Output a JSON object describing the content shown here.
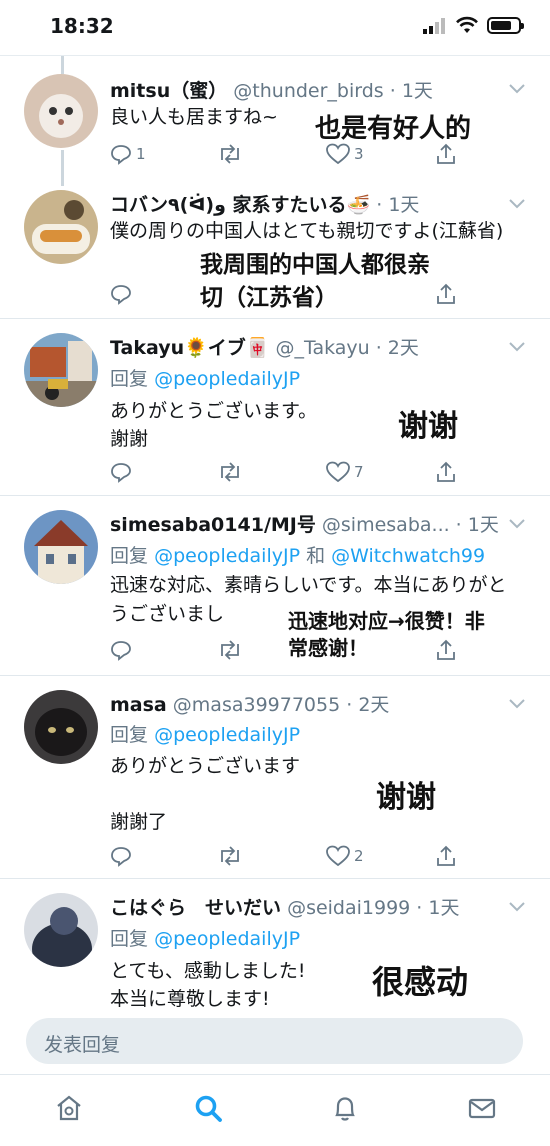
{
  "status_bar": {
    "time": "18:32"
  },
  "tweets": [
    {
      "name": "mitsu（蜜）",
      "meta": "@thunder_birds · 1天",
      "text": "良い人も居ますね~",
      "overlay": "也是有好人的",
      "reply_count": "1",
      "like_count": "3"
    },
    {
      "name": "コバン٩(ᐛ)و 家系すたいる🍜",
      "name_prefix": "",
      "meta": " · 1天",
      "text": "僕の周りの中国人はとても親切ですよ(江蘇省)",
      "overlay": "我周围的中国人都很亲切（江苏省）",
      "overlay_line1": "我周围的中国人都很亲",
      "overlay_line2": "切（江苏省）"
    },
    {
      "name": "Takayu🌻イブ🀄",
      "meta": "@_Takayu · 2天",
      "reply_prefix": "回复",
      "reply_to": "@peopledailyJP",
      "text_line1": "ありがとうございます。",
      "text_line2": "謝謝",
      "overlay": "谢谢",
      "like_count": "7"
    },
    {
      "name": "simesaba0141/MJ号",
      "meta": "@simesaba... · 1天",
      "reply_prefix": "回复",
      "reply_to": "@peopledailyJP",
      "reply_and": "和",
      "reply_to2": "@Witchwatch99",
      "text": "迅速な対応、素晴らしいです。本当にありがとうございまし",
      "overlay_line1": "迅速地对应→很赞！非",
      "overlay_line2": "常感谢！"
    },
    {
      "name": "masa",
      "meta": "@masa39977055 · 2天",
      "reply_prefix": "回复",
      "reply_to": "@peopledailyJP",
      "text_line1": "ありがとうございます",
      "text_line2": "謝謝了",
      "overlay": "谢谢",
      "like_count": "2"
    },
    {
      "name": "こはぐら　せいだい",
      "meta": "@seidai1999 · 1天",
      "reply_prefix": "回复",
      "reply_to": "@peopledailyJP",
      "text_line1": "とても、感動しました!",
      "text_line2": "本当に尊敬します!",
      "overlay": "很感动"
    }
  ],
  "reply_box": {
    "placeholder": "发表回复"
  },
  "tabbar": {
    "tabs": [
      {
        "icon": "home-icon"
      },
      {
        "icon": "search-icon",
        "active": true
      },
      {
        "icon": "notifications-icon"
      },
      {
        "icon": "messages-icon"
      }
    ]
  },
  "colors": {
    "accent": "#1da1f2",
    "muted": "#657786",
    "border": "#e1e8ed"
  }
}
